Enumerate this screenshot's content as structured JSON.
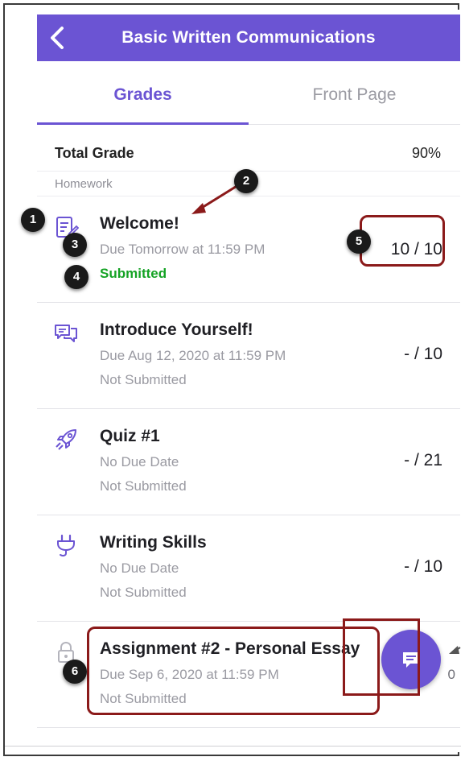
{
  "header": {
    "title": "Basic Written Communications"
  },
  "tabs": [
    {
      "label": "Grades"
    },
    {
      "label": "Front Page"
    }
  ],
  "total": {
    "label": "Total Grade",
    "value": "90%"
  },
  "section": {
    "label": "Homework"
  },
  "items": [
    {
      "title": "Welcome!",
      "due": "Due Tomorrow at 11:59 PM",
      "status": "Submitted",
      "grade": "10 / 10",
      "icon": "assignment-icon"
    },
    {
      "title": "Introduce Yourself!",
      "due": "Due Aug 12, 2020 at 11:59 PM",
      "status": "Not Submitted",
      "grade": "- / 10",
      "icon": "discussion-icon"
    },
    {
      "title": "Quiz #1",
      "due": "No Due Date",
      "status": "Not Submitted",
      "grade": "- / 21",
      "icon": "quiz-rocket-icon"
    },
    {
      "title": "Writing Skills",
      "due": "No Due Date",
      "status": "Not Submitted",
      "grade": "- / 10",
      "icon": "external-tool-plug-icon"
    },
    {
      "title": "Assignment #2 - Personal Essay",
      "due": "Due Sep 6, 2020 at 11:59 PM",
      "status": "Not Submitted",
      "grade": "0",
      "icon": "lock-icon"
    }
  ],
  "callouts": [
    "1",
    "2",
    "3",
    "4",
    "5",
    "6"
  ],
  "colors": {
    "brand": "#6b54d3",
    "submitted": "#15a325",
    "highlight": "#8b1a1a"
  }
}
